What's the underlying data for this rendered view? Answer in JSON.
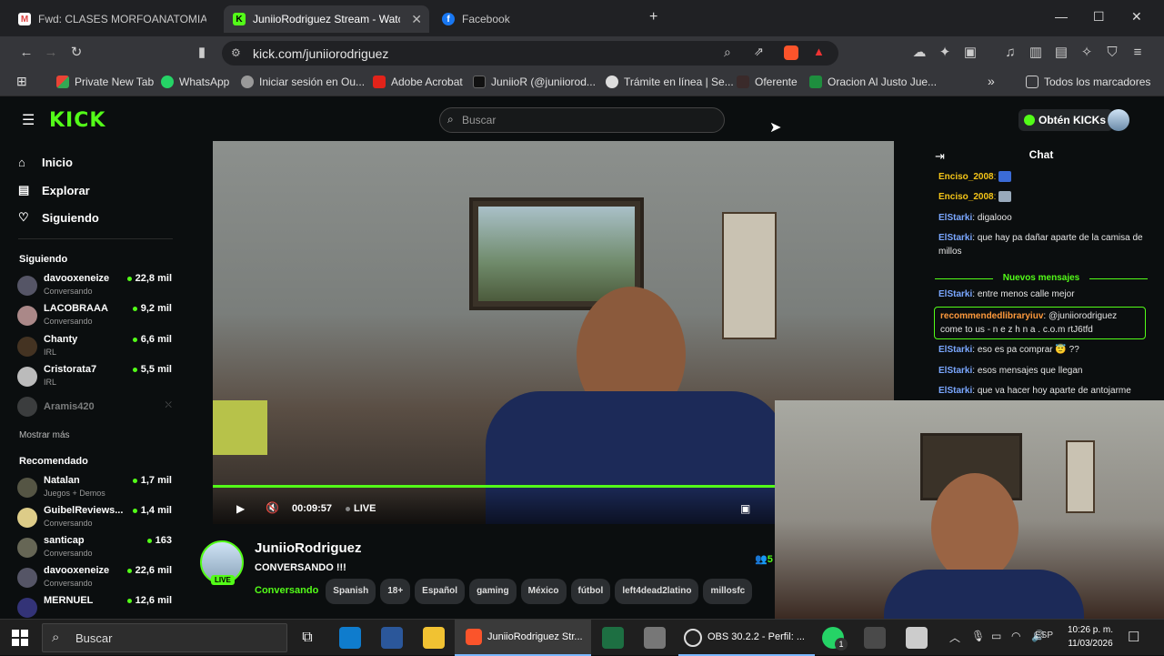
{
  "browser": {
    "tabs": [
      {
        "label": "Fwd: CLASES MORFOANATOMIA - ar",
        "icon": "gmail-icon"
      },
      {
        "label": "JuniioRodriguez Stream - Watch",
        "icon": "kick-icon"
      },
      {
        "label": "Facebook",
        "icon": "facebook-icon"
      }
    ],
    "url": "kick.com/juniiorodriguez",
    "bookmarks": [
      "Private New Tab",
      "WhatsApp",
      "Iniciar sesión en Ou...",
      "Adobe Acrobat",
      "JuniioR (@juniiorod...",
      "Trámite en línea | Se...",
      "Oferente",
      "Oracion Al Justo Jue..."
    ],
    "all_bookmarks": "Todos los marcadores"
  },
  "kick": {
    "search_placeholder": "Buscar",
    "obten_kicks": "Obtén KICKs",
    "logo": "KICK",
    "nav": [
      "Inicio",
      "Explorar",
      "Siguiendo"
    ],
    "following_title": "Siguiendo",
    "following": [
      {
        "name": "davooxeneize",
        "category": "Conversando",
        "viewers": "22,8 mil"
      },
      {
        "name": "LACOBRAAA",
        "category": "Conversando",
        "viewers": "9,2 mil"
      },
      {
        "name": "Chanty",
        "category": "IRL",
        "viewers": "6,6 mil"
      },
      {
        "name": "Cristorata7",
        "category": "IRL",
        "viewers": "5,5 mil"
      },
      {
        "name": "Aramis420",
        "category": "",
        "viewers": ""
      }
    ],
    "show_more": "Mostrar más",
    "recommended_title": "Recomendado",
    "recommended": [
      {
        "name": "Natalan",
        "category": "Juegos + Demos",
        "viewers": "1,7 mil"
      },
      {
        "name": "GuibelReviews...",
        "category": "Conversando",
        "viewers": "1,4 mil"
      },
      {
        "name": "santicap",
        "category": "Conversando",
        "viewers": "163"
      },
      {
        "name": "davooxeneize",
        "category": "Conversando",
        "viewers": "22,6 mil"
      },
      {
        "name": "MERNUEL",
        "category": "",
        "viewers": "12,6 mil"
      }
    ],
    "player": {
      "time": "00:09:57",
      "live": "LIVE",
      "progress": 1.0
    },
    "streamer": {
      "name": "JuniioRodriguez",
      "title": "CONVERSANDO !!!",
      "category": "Conversando",
      "live_badge": "LIVE",
      "viewers": "5",
      "tags": [
        "Spanish",
        "18+",
        "Español",
        "gaming",
        "México",
        "fútbol",
        "left4dead2latino",
        "millosfc"
      ]
    },
    "chat": {
      "title": "Chat",
      "new_messages": "Nuevos mensajes",
      "messages": [
        {
          "user": "Enciso_2008",
          "text": "",
          "color": "#f5c518"
        },
        {
          "user": "Enciso_2008",
          "text": "",
          "color": "#f5c518"
        },
        {
          "user": "ElStarki",
          "text": "digalooo",
          "color": "#7aa7ff"
        },
        {
          "user": "ElStarki",
          "text": "que hay pa dañar aparte de la camisa de millos",
          "color": "#7aa7ff"
        },
        {
          "user": "ElStarki",
          "text": "entre menos calle mejor",
          "color": "#7aa7ff"
        },
        {
          "user": "recommendedlibraryiuv",
          "text": "@juniiorodriguez come to us - n e z h n a . c.o.m rtJ6tfd",
          "color": "#ff9a3c"
        },
        {
          "user": "ElStarki",
          "text": "eso es pa comprar 😇 ??",
          "color": "#7aa7ff"
        },
        {
          "user": "ElStarki",
          "text": "esos mensajes que llegan",
          "color": "#7aa7ff"
        },
        {
          "user": "ElStarki",
          "text": "que va hacer hoy aparte de antojarme",
          "color": "#7aa7ff"
        }
      ]
    }
  },
  "taskbar": {
    "search": "Buscar",
    "apps": [
      {
        "label": "JuniioRodriguez Str..."
      },
      {
        "label": "OBS 30.2.2 - Perfil: ..."
      }
    ],
    "lang": "ESP",
    "time": "10:26 p. m.",
    "date": "11/03/2026",
    "whatsapp_badge": "1"
  },
  "colors": {
    "accent": "#53fc18",
    "bg": "#0b0e0f"
  }
}
